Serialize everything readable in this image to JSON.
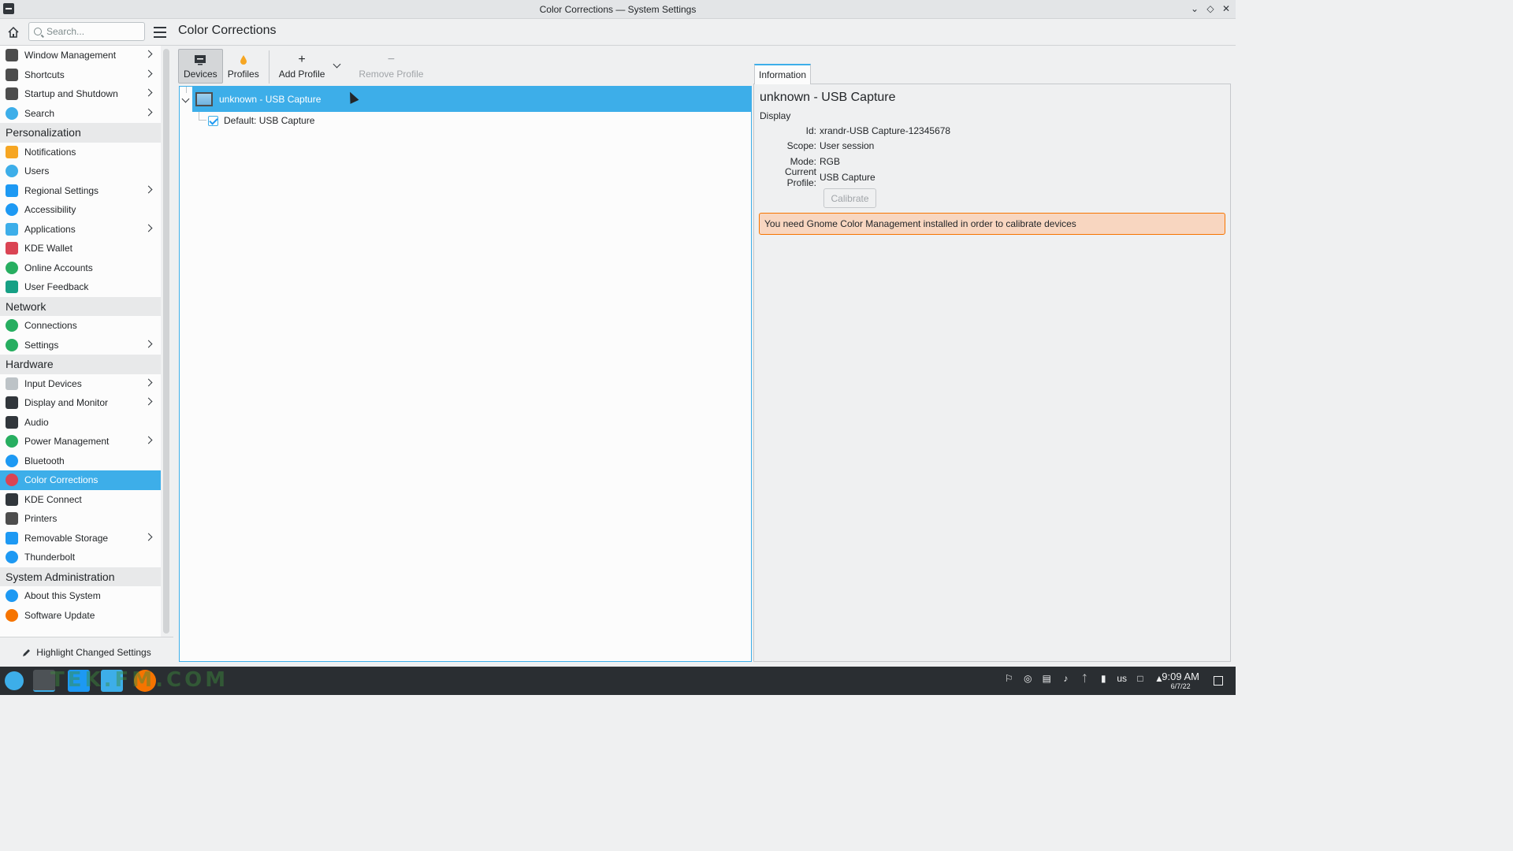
{
  "window": {
    "title": "Color Corrections — System Settings"
  },
  "header": {
    "search_placeholder": "Search...",
    "page_title": "Color Corrections"
  },
  "sidebar": {
    "entries": [
      {
        "type": "item",
        "label": "Window Management",
        "icon": "window-icon",
        "color": "#4d4d4d",
        "chevron": true
      },
      {
        "type": "item",
        "label": "Shortcuts",
        "icon": "keyboard-icon",
        "color": "#4d4d4d",
        "chevron": true
      },
      {
        "type": "item",
        "label": "Startup and Shutdown",
        "icon": "power-window-icon",
        "color": "#4d4d4d",
        "chevron": true
      },
      {
        "type": "item",
        "label": "Search",
        "icon": "search-icon",
        "color": "#3daee9",
        "chevron": true
      },
      {
        "type": "category",
        "label": "Personalization"
      },
      {
        "type": "item",
        "label": "Notifications",
        "icon": "bell-icon",
        "color": "#f6a623",
        "chevron": false
      },
      {
        "type": "item",
        "label": "Users",
        "icon": "users-icon",
        "color": "#3daee9",
        "chevron": false
      },
      {
        "type": "item",
        "label": "Regional Settings",
        "icon": "flag-icon",
        "color": "#1d99f3",
        "chevron": true
      },
      {
        "type": "item",
        "label": "Accessibility",
        "icon": "accessibility-icon",
        "color": "#1d99f3",
        "chevron": false
      },
      {
        "type": "item",
        "label": "Applications",
        "icon": "applications-icon",
        "color": "#3daee9",
        "chevron": true
      },
      {
        "type": "item",
        "label": "KDE Wallet",
        "icon": "wallet-icon",
        "color": "#da4453",
        "chevron": false
      },
      {
        "type": "item",
        "label": "Online Accounts",
        "icon": "globe-icon",
        "color": "#27ae60",
        "chevron": false
      },
      {
        "type": "item",
        "label": "User Feedback",
        "icon": "feedback-icon",
        "color": "#16a085",
        "chevron": false
      },
      {
        "type": "category",
        "label": "Network"
      },
      {
        "type": "item",
        "label": "Connections",
        "icon": "globe-icon",
        "color": "#27ae60",
        "chevron": false
      },
      {
        "type": "item",
        "label": "Settings",
        "icon": "globe-icon",
        "color": "#27ae60",
        "chevron": true
      },
      {
        "type": "category",
        "label": "Hardware"
      },
      {
        "type": "item",
        "label": "Input Devices",
        "icon": "mouse-icon",
        "color": "#bdc3c7",
        "chevron": true
      },
      {
        "type": "item",
        "label": "Display and Monitor",
        "icon": "monitor-icon",
        "color": "#31363b",
        "chevron": true
      },
      {
        "type": "item",
        "label": "Audio",
        "icon": "speaker-icon",
        "color": "#31363b",
        "chevron": false
      },
      {
        "type": "item",
        "label": "Power Management",
        "icon": "battery-icon",
        "color": "#27ae60",
        "chevron": true
      },
      {
        "type": "item",
        "label": "Bluetooth",
        "icon": "bluetooth-icon",
        "color": "#1d99f3",
        "chevron": false
      },
      {
        "type": "item",
        "label": "Color Corrections",
        "icon": "color-wheel-icon",
        "color": "#da4453",
        "chevron": false,
        "active": true
      },
      {
        "type": "item",
        "label": "KDE Connect",
        "icon": "phone-icon",
        "color": "#31363b",
        "chevron": false
      },
      {
        "type": "item",
        "label": "Printers",
        "icon": "printer-icon",
        "color": "#4d4d4d",
        "chevron": false
      },
      {
        "type": "item",
        "label": "Removable Storage",
        "icon": "usb-drive-icon",
        "color": "#1d99f3",
        "chevron": true
      },
      {
        "type": "item",
        "label": "Thunderbolt",
        "icon": "thunderbolt-icon",
        "color": "#1d99f3",
        "chevron": false
      },
      {
        "type": "category",
        "label": "System Administration"
      },
      {
        "type": "item",
        "label": "About this System",
        "icon": "info-icon",
        "color": "#1d99f3",
        "chevron": false
      },
      {
        "type": "item",
        "label": "Software Update",
        "icon": "update-icon",
        "color": "#f67400",
        "chevron": false
      }
    ],
    "footer_label": "Highlight Changed Settings"
  },
  "toolbar": {
    "devices_label": "Devices",
    "profiles_label": "Profiles",
    "add_profile_label": "Add Profile",
    "remove_profile_label": "Remove Profile"
  },
  "tree": {
    "device_label": "unknown - USB Capture",
    "profile_label": "Default: USB Capture"
  },
  "info": {
    "tab_label": "Information",
    "heading": "unknown - USB Capture",
    "kind": "Display",
    "rows": [
      {
        "key": "Id:",
        "value": "xrandr-USB Capture-12345678"
      },
      {
        "key": "Scope:",
        "value": "User session"
      },
      {
        "key": "Mode:",
        "value": "RGB"
      },
      {
        "key": "Current Profile:",
        "value": "USB Capture"
      }
    ],
    "calibrate_label": "Calibrate",
    "warning": "You need Gnome Color Management installed in order to calibrate devices"
  },
  "taskbar": {
    "time": "9:09 AM",
    "date": "6/7/22",
    "keyboard_layout": "us",
    "watermark": "TEK.FM.COM"
  }
}
